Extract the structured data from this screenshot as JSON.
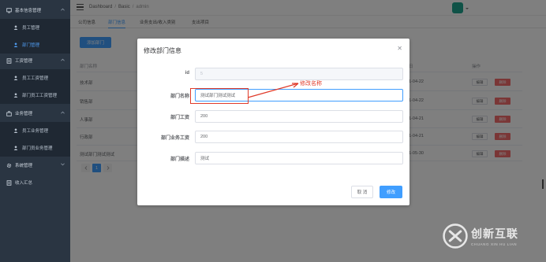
{
  "sidebar": {
    "groups": [
      {
        "label": "基本信息管理",
        "icon": "monitor-icon",
        "items": [
          {
            "label": "员工管理",
            "icon": "user-icon",
            "active": false
          },
          {
            "label": "部门管理",
            "icon": "user-icon",
            "active": true
          }
        ]
      },
      {
        "label": "工资管理",
        "icon": "document-icon",
        "items": [
          {
            "label": "员工工资管理",
            "icon": "user-icon",
            "active": false
          },
          {
            "label": "部门员工工资管理",
            "icon": "user-icon",
            "active": false
          }
        ]
      },
      {
        "label": "业务管理",
        "icon": "briefcase-icon",
        "items": [
          {
            "label": "员工业务管理",
            "icon": "user-icon",
            "active": false
          },
          {
            "label": "部门员业务管理",
            "icon": "user-icon",
            "active": false
          }
        ]
      },
      {
        "label": "系统管理",
        "icon": "gear-icon",
        "items": []
      },
      {
        "label": "收入汇总",
        "icon": "document-icon",
        "items": []
      }
    ]
  },
  "breadcrumb": {
    "items": [
      "Dashboard",
      "Basic",
      "admin"
    ]
  },
  "tabs": [
    {
      "label": "公司信息",
      "active": false
    },
    {
      "label": "部门信息",
      "active": true
    },
    {
      "label": "业务支出/收入类别",
      "active": false
    },
    {
      "label": "支出项目",
      "active": false
    }
  ],
  "toolbar": {
    "add_label": "添加部门"
  },
  "table": {
    "headers": {
      "name": "部门名称",
      "date": "日",
      "actions": "操作"
    },
    "rows": [
      {
        "name": "技术部",
        "date": "1-04-22"
      },
      {
        "name": "销售部",
        "date": "1-04-22"
      },
      {
        "name": "人事部",
        "date": "1-04-21"
      },
      {
        "name": "行政部",
        "date": "1-04-21"
      },
      {
        "name": "测试部门测试测试",
        "date": "1-05-30"
      }
    ],
    "edit_label": "编辑",
    "delete_label": "删除"
  },
  "pagination": {
    "current": "1"
  },
  "modal": {
    "title": "修改部门信息",
    "fields": [
      {
        "label": "id",
        "value": "5",
        "disabled": true
      },
      {
        "label": "部门名称",
        "value": "测试部门测试测试",
        "disabled": false
      },
      {
        "label": "部门工资",
        "value": "200",
        "disabled": false
      },
      {
        "label": "部门业务工资",
        "value": "200",
        "disabled": false
      },
      {
        "label": "部门描述",
        "value": "测试",
        "disabled": false
      }
    ],
    "cancel_label": "取 消",
    "confirm_label": "修改"
  },
  "annotation": {
    "text": "修改名称",
    "color": "#e03b2a"
  },
  "watermark": {
    "cn": "创新互联",
    "en": "CHUANG XIN HU LIAN"
  },
  "colors": {
    "primary": "#409eff",
    "danger": "#f56c6c",
    "sidebar": "#2a3542"
  }
}
